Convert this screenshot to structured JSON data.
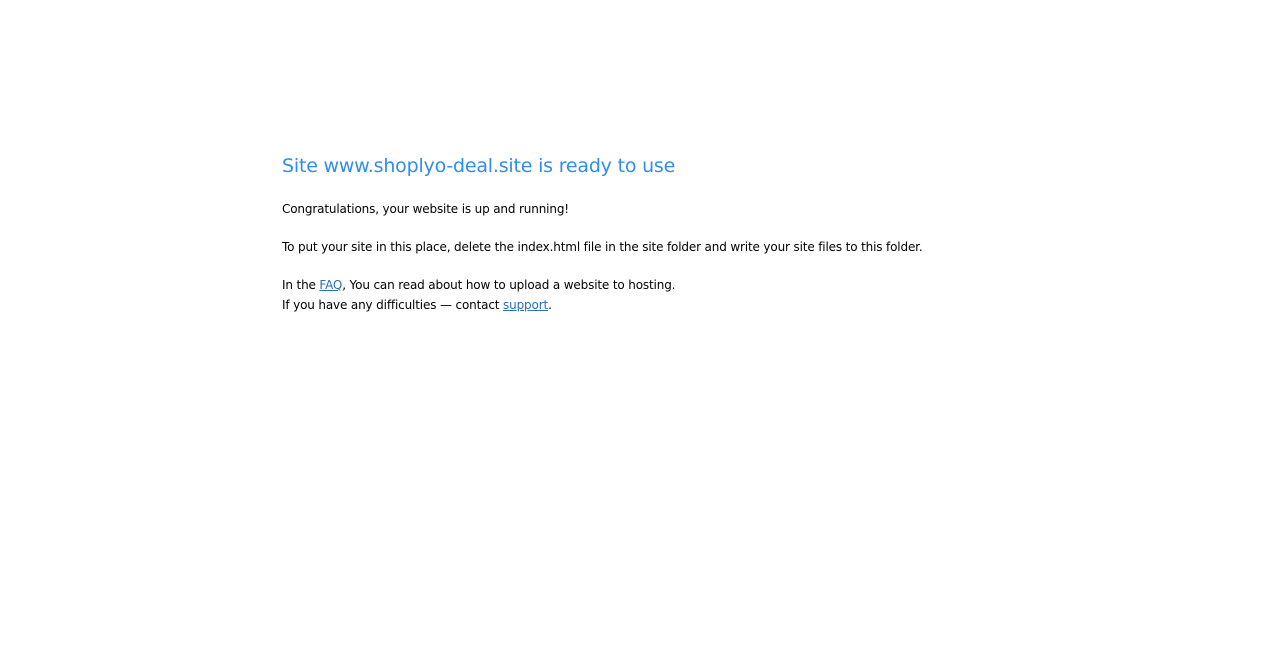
{
  "heading": {
    "title": "Site www.shoplyo-deal.site is ready to use"
  },
  "body": {
    "congrats": "Congratulations, your website is up and running!",
    "instructions": "To put your site in this place, delete the index.html file in the site folder and write your site files to this folder.",
    "faq_prefix": "In the ",
    "faq_link": "FAQ",
    "faq_suffix": ", You can read about how to upload a website to hosting.",
    "support_prefix": "If you have any difficulties — contact ",
    "support_link": "support",
    "support_suffix": "."
  },
  "colors": {
    "title": "#2f8ded",
    "link": "#2a6fb1",
    "text": "#000000",
    "background": "#ffffff"
  }
}
